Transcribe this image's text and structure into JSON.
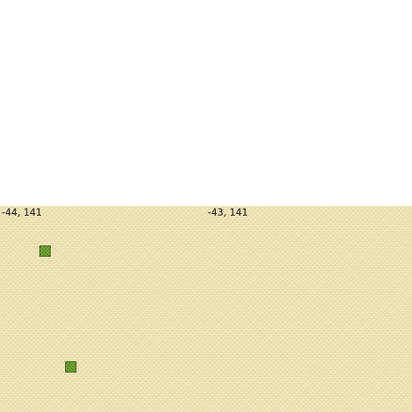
{
  "map": {
    "tiles": [
      {
        "coord_label": "-44, 141",
        "terrain": "sand"
      },
      {
        "coord_label": "-43, 141",
        "terrain": "sand"
      }
    ],
    "blocks": [
      {
        "type": "grass",
        "color": "#6a9a2d"
      },
      {
        "type": "grass",
        "color": "#6a9a2d"
      }
    ],
    "colors": {
      "sand": "#ece0b1",
      "grass": "#6a9a2d",
      "empty": "#ffffff"
    }
  }
}
